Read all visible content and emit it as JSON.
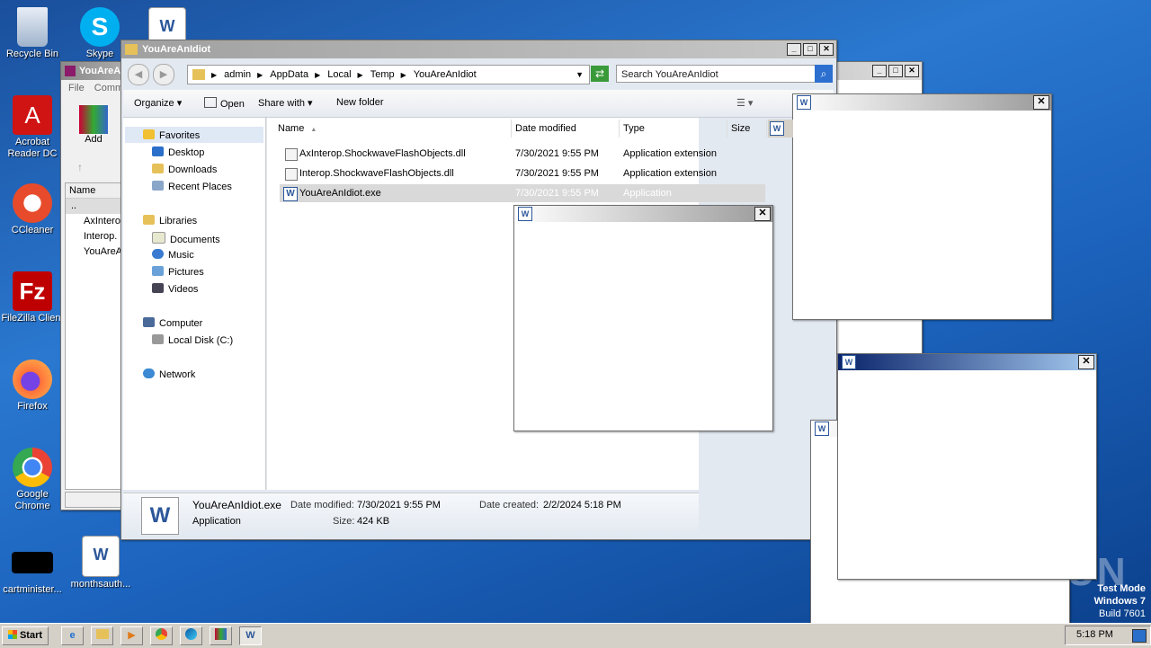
{
  "desktop": {
    "icons": [
      {
        "label": "Recycle Bin",
        "icon": "recycle-bin-icon",
        "color": "#b7c9e0"
      },
      {
        "label": "Skype",
        "icon": "skype-icon",
        "color": "#00aff0"
      },
      {
        "label": "Acrobat Reader DC",
        "l1": "Acrobat",
        "l2": "Reader DC",
        "icon": "acrobat-icon",
        "color": "#d01313"
      },
      {
        "label": "CCleaner",
        "icon": "ccleaner-icon",
        "color": "#e74b2b"
      },
      {
        "label": "FileZilla Client",
        "icon": "filezilla-icon",
        "color": "#bf0000"
      },
      {
        "label": "Firefox",
        "icon": "firefox-icon",
        "color": "#ff7139"
      },
      {
        "label": "Google Chrome",
        "l1": "Google",
        "l2": "Chrome",
        "icon": "chrome-icon",
        "color": "#34a853"
      },
      {
        "label": "cartminister...",
        "icon": "black-file-icon",
        "color": "#000000"
      },
      {
        "label": "monthsauth...",
        "icon": "word-doc-icon",
        "color": "#ffffff"
      }
    ],
    "watermark": "ANY RUN",
    "test_mode": {
      "line1": "Test Mode",
      "line2": "Windows 7",
      "line3": "Build 7601"
    }
  },
  "winrar": {
    "title": "YouAreA",
    "menu": [
      "File",
      "Comm"
    ],
    "add_label": "Add",
    "col_name": "Name",
    "items": [
      "..",
      "AxInterop",
      "Interop.",
      "YouAreA"
    ]
  },
  "explorer": {
    "title": "YouAreAnIdiot",
    "breadcrumbs": [
      "admin",
      "AppData",
      "Local",
      "Temp",
      "YouAreAnIdiot"
    ],
    "search_placeholder": "Search YouAreAnIdiot",
    "toolbar": {
      "organize": "Organize",
      "open": "Open",
      "share": "Share with",
      "new_folder": "New folder"
    },
    "nav": {
      "favorites": "Favorites",
      "fav_items": [
        "Desktop",
        "Downloads",
        "Recent Places"
      ],
      "libraries": "Libraries",
      "lib_items": [
        "Documents",
        "Music",
        "Pictures",
        "Videos"
      ],
      "computer": "Computer",
      "comp_items": [
        "Local Disk (C:)"
      ],
      "network": "Network"
    },
    "columns": {
      "name": "Name",
      "date": "Date modified",
      "type": "Type",
      "size": "Size"
    },
    "files": [
      {
        "name": "AxInterop.ShockwaveFlashObjects.dll",
        "date": "7/30/2021 9:55 PM",
        "type": "Application extension"
      },
      {
        "name": "Interop.ShockwaveFlashObjects.dll",
        "date": "7/30/2021 9:55 PM",
        "type": "Application extension"
      },
      {
        "name": "YouAreAnIdiot.exe",
        "date": "7/30/2021 9:55 PM",
        "type": "Application"
      }
    ],
    "details": {
      "filename": "YouAreAnIdiot.exe",
      "modified_label": "Date modified:",
      "modified": "7/30/2021 9:55 PM",
      "created_label": "Date created:",
      "created": "2/2/2024 5:18 PM",
      "kind": "Application",
      "size_label": "Size:",
      "size": "424 KB"
    }
  },
  "taskbar": {
    "start": "Start",
    "clock": "5:18 PM"
  }
}
